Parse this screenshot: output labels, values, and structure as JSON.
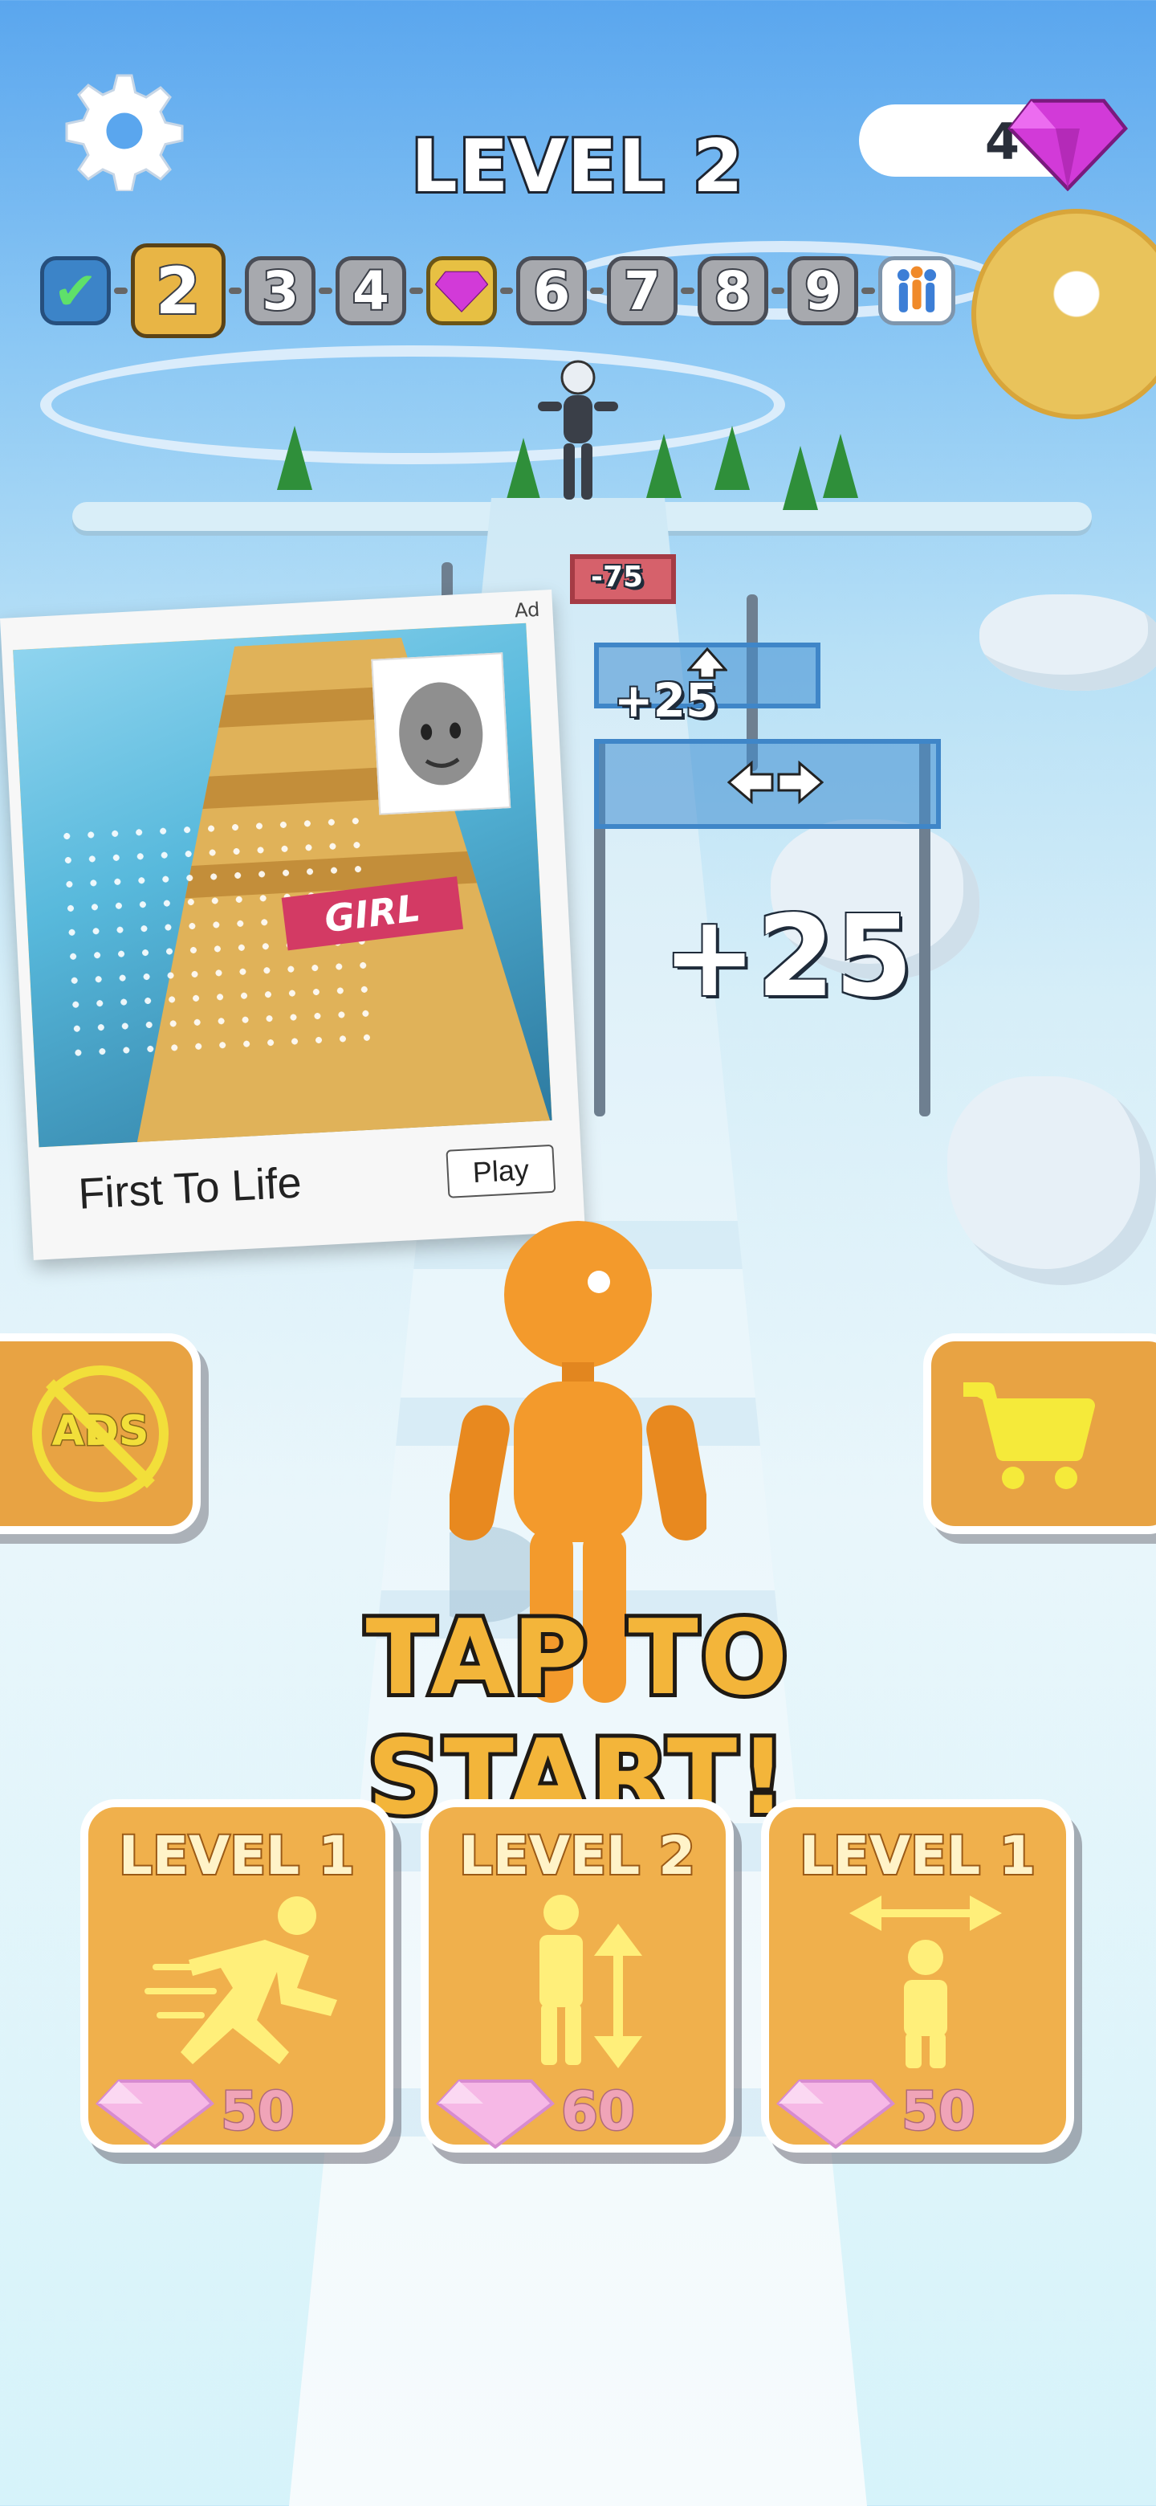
{
  "header": {
    "level_title": "LEVEL 2",
    "gem_count": "4"
  },
  "progress": {
    "nodes": [
      {
        "label": "",
        "state": "done"
      },
      {
        "label": "2",
        "state": "current"
      },
      {
        "label": "3",
        "state": "locked"
      },
      {
        "label": "4",
        "state": "locked"
      },
      {
        "label": "",
        "state": "gem"
      },
      {
        "label": "6",
        "state": "locked"
      },
      {
        "label": "7",
        "state": "locked"
      },
      {
        "label": "8",
        "state": "locked"
      },
      {
        "label": "9",
        "state": "locked"
      },
      {
        "label": "",
        "state": "crowd"
      }
    ]
  },
  "scene": {
    "gate_near_value": "+25",
    "gate_mid_value": "+25",
    "gate_far_value": "-75"
  },
  "ad": {
    "tag": "Ad",
    "banner_text": "GIRL",
    "app_name": "First To Life",
    "cta": "Play"
  },
  "buttons": {
    "no_ads_label": "ADS"
  },
  "start_prompt": "TAP TO START!",
  "upgrades": [
    {
      "title": "LEVEL 1",
      "cost": "50",
      "icon": "running-man-icon"
    },
    {
      "title": "LEVEL 2",
      "cost": "60",
      "icon": "height-icon"
    },
    {
      "title": "LEVEL 1",
      "cost": "50",
      "icon": "width-icon"
    }
  ],
  "colors": {
    "orange": "#e8a343",
    "gem_pink": "#d23ad8",
    "sky": "#5aa6ee"
  }
}
